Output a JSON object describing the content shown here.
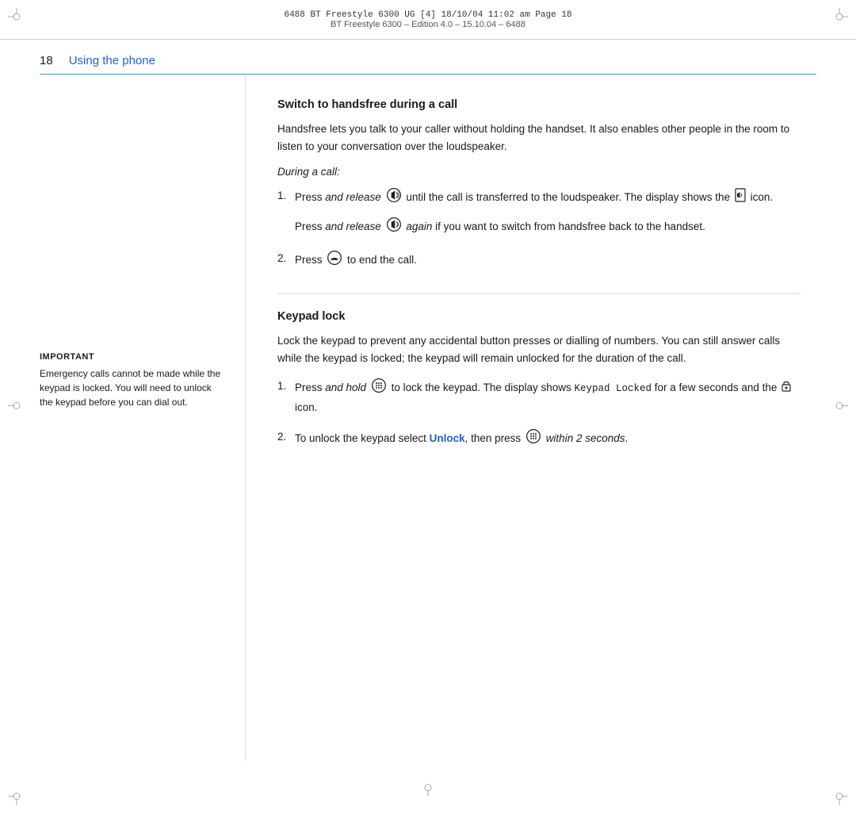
{
  "header": {
    "line1": "6488 BT Freestyle 6300 UG [4]  18/10/04  11:02 am  Page 18",
    "line2": "BT Freestyle 6300 – Edition 4.0 – 15.10.04 – 6488"
  },
  "page": {
    "number": "18",
    "title": "Using the phone"
  },
  "important": {
    "label": "IMPORTANT",
    "text": "Emergency calls cannot be made while the keypad is locked. You will need to unlock the keypad before you can dial out."
  },
  "section1": {
    "title": "Switch to handsfree during a call",
    "body": "Handsfree lets you talk to your caller without holding the handset. It also enables other people in the room to listen to your conversation over the loudspeaker.",
    "italic_label": "During a call:",
    "steps": [
      {
        "num": "1.",
        "main": "Press and release [speaker] until the call is transferred to the loudspeaker. The display shows the [loudspeaker] icon.",
        "sub": "Press and release [speaker] again if you want to switch from handsfree back to the handset."
      },
      {
        "num": "2.",
        "main": "Press [end] to end the call.",
        "sub": ""
      }
    ]
  },
  "section2": {
    "title": "Keypad lock",
    "body": "Lock the keypad to prevent any accidental button presses or dialling of numbers. You can still answer calls while the keypad is locked; the keypad will remain unlocked for the duration of the call.",
    "steps": [
      {
        "num": "1.",
        "main": "Press and hold [keypad] to lock the keypad. The display shows Keypad Locked for a few seconds and the [lock] icon.",
        "sub": ""
      },
      {
        "num": "2.",
        "main": "To unlock the keypad select Unlock, then press [keypad] within 2 seconds.",
        "sub": ""
      }
    ]
  }
}
